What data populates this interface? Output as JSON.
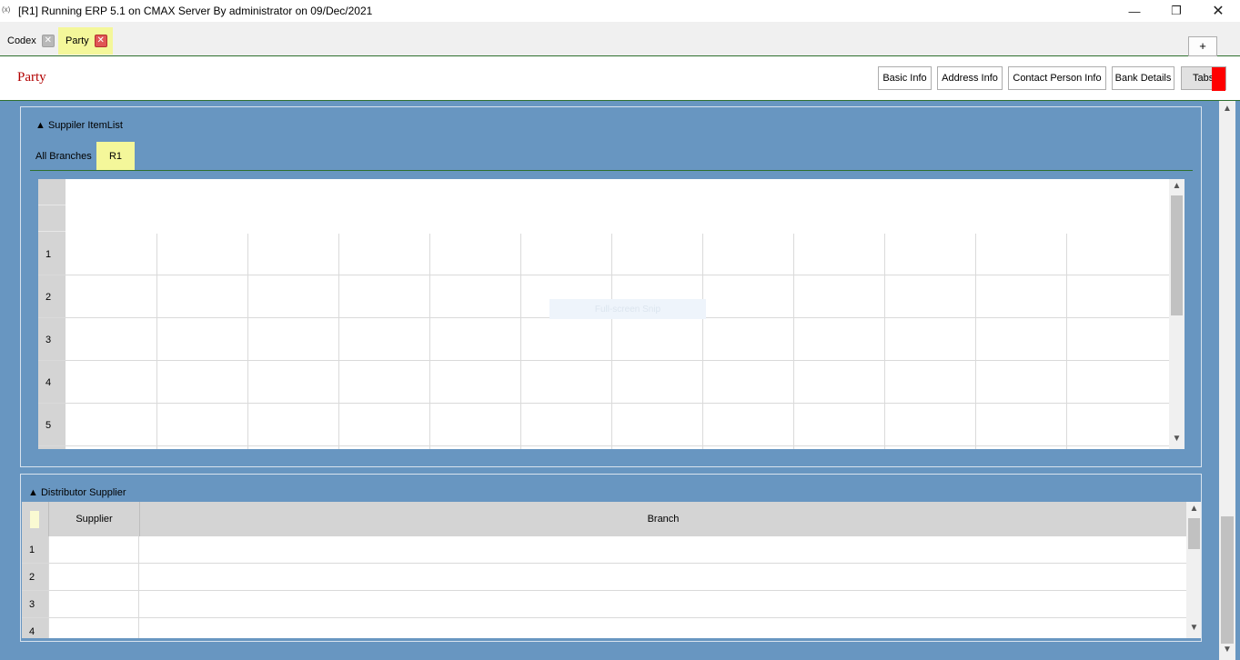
{
  "window": {
    "title": "[R1] Running ERP 5.1 on CMAX Server By administrator on 09/Dec/2021",
    "minimize_glyph": "—",
    "maximize_glyph": "❐",
    "close_glyph": "✕"
  },
  "doc_tabs": [
    {
      "label": "Codex",
      "close": "✕"
    },
    {
      "label": "Party",
      "close": "✕",
      "active": true
    }
  ],
  "new_tab_label": "+",
  "header": {
    "title": "Party",
    "buttons": {
      "basic_info": "Basic Info",
      "address_info": "Address Info",
      "contact_person_info": "Contact Person Info",
      "bank_details": "Bank Details",
      "tabs": "Tabs"
    }
  },
  "supplier_item_list": {
    "title": "▲ Suppiler ItemList",
    "tabs": {
      "all": "All Branches",
      "r1": "R1"
    },
    "rows": [
      "1",
      "2",
      "3",
      "4",
      "5"
    ],
    "overlay_text": "Full-screen Snip"
  },
  "distributor_supplier": {
    "title": "▲ Distributor Supplier",
    "columns": {
      "supplier": "Supplier",
      "branch": "Branch"
    },
    "rows": [
      "1",
      "2",
      "3",
      "4"
    ]
  },
  "scroll_glyphs": {
    "up": "▲",
    "down": "▼"
  },
  "colors": {
    "accent_green": "#2e6f2e",
    "panel_blue": "#6896c1",
    "active_tab_yellow": "#f4f79a",
    "title_red": "#b20000",
    "tabs_red": "#ff0000"
  }
}
